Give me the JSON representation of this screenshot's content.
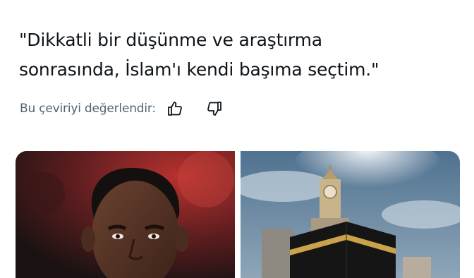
{
  "tweet": {
    "text_line1": "\"Dikkatli bir düşünme ve araştırma",
    "text_line2": "sonrasında, İslam'ı kendi başıma seçtim.\""
  },
  "translation_rating": {
    "label": "Bu çeviriyi değerlendir:",
    "thumb_up_icon": "thumbs-up-icon",
    "thumb_down_icon": "thumbs-down-icon"
  },
  "media": {
    "images": [
      {
        "name": "player-portrait-photo"
      },
      {
        "name": "kaaba-clock-tower-photo"
      }
    ]
  },
  "colors": {
    "text": "#0f1419",
    "secondary": "#536471"
  }
}
